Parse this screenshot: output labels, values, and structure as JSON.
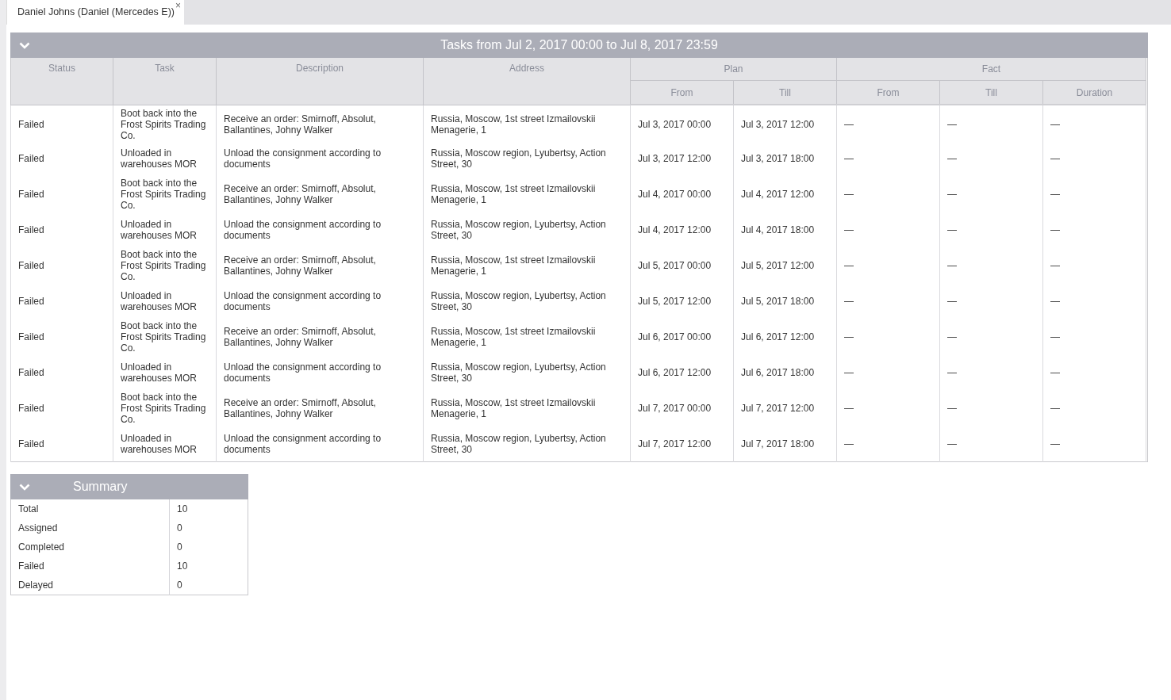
{
  "tab": {
    "label": "Daniel Johns (Daniel (Mercedes E))",
    "close": "×"
  },
  "tasks": {
    "title": "Tasks from Jul 2, 2017 00:00 to Jul 8, 2017 23:59",
    "columns": [
      "Status",
      "Task",
      "Description",
      "Address"
    ],
    "groups": [
      {
        "label": "Plan",
        "columns": [
          "From",
          "Till"
        ]
      },
      {
        "label": "Fact",
        "columns": [
          "From",
          "Till",
          "Duration"
        ]
      }
    ],
    "rows": [
      {
        "status": "Failed",
        "task": "Boot back into the Frost Spirits Trading Co.",
        "description": "Receive an order: Smirnoff, Absolut, Ballantines, Johny Walker",
        "address": "Russia, Moscow, 1st street Izmailovskii Menagerie, 1",
        "plan_from": "Jul 3, 2017 00:00",
        "plan_till": "Jul 3, 2017 12:00",
        "fact_from": "—",
        "fact_till": "—",
        "duration": "—"
      },
      {
        "status": "Failed",
        "task": "Unloaded in warehouses MOR",
        "description": "Unload the consignment according to documents",
        "address": "Russia, Moscow region, Lyubertsy, Action Street, 30",
        "plan_from": "Jul 3, 2017 12:00",
        "plan_till": "Jul 3, 2017 18:00",
        "fact_from": "—",
        "fact_till": "—",
        "duration": "—"
      },
      {
        "status": "Failed",
        "task": "Boot back into the Frost Spirits Trading Co.",
        "description": "Receive an order: Smirnoff, Absolut, Ballantines, Johny Walker",
        "address": "Russia, Moscow, 1st street Izmailovskii Menagerie, 1",
        "plan_from": "Jul 4, 2017 00:00",
        "plan_till": "Jul 4, 2017 12:00",
        "fact_from": "—",
        "fact_till": "—",
        "duration": "—"
      },
      {
        "status": "Failed",
        "task": "Unloaded in warehouses MOR",
        "description": "Unload the consignment according to documents",
        "address": "Russia, Moscow region, Lyubertsy, Action Street, 30",
        "plan_from": "Jul 4, 2017 12:00",
        "plan_till": "Jul 4, 2017 18:00",
        "fact_from": "—",
        "fact_till": "—",
        "duration": "—"
      },
      {
        "status": "Failed",
        "task": "Boot back into the Frost Spirits Trading Co.",
        "description": "Receive an order: Smirnoff, Absolut, Ballantines, Johny Walker",
        "address": "Russia, Moscow, 1st street Izmailovskii Menagerie, 1",
        "plan_from": "Jul 5, 2017 00:00",
        "plan_till": "Jul 5, 2017 12:00",
        "fact_from": "—",
        "fact_till": "—",
        "duration": "—"
      },
      {
        "status": "Failed",
        "task": "Unloaded in warehouses MOR",
        "description": "Unload the consignment according to documents",
        "address": "Russia, Moscow region, Lyubertsy, Action Street, 30",
        "plan_from": "Jul 5, 2017 12:00",
        "plan_till": "Jul 5, 2017 18:00",
        "fact_from": "—",
        "fact_till": "—",
        "duration": "—"
      },
      {
        "status": "Failed",
        "task": "Boot back into the Frost Spirits Trading Co.",
        "description": "Receive an order: Smirnoff, Absolut, Ballantines, Johny Walker",
        "address": "Russia, Moscow, 1st street Izmailovskii Menagerie, 1",
        "plan_from": "Jul 6, 2017 00:00",
        "plan_till": "Jul 6, 2017 12:00",
        "fact_from": "—",
        "fact_till": "—",
        "duration": "—"
      },
      {
        "status": "Failed",
        "task": "Unloaded in warehouses MOR",
        "description": "Unload the consignment according to documents",
        "address": "Russia, Moscow region, Lyubertsy, Action Street, 30",
        "plan_from": "Jul 6, 2017 12:00",
        "plan_till": "Jul 6, 2017 18:00",
        "fact_from": "—",
        "fact_till": "—",
        "duration": "—"
      },
      {
        "status": "Failed",
        "task": "Boot back into the Frost Spirits Trading Co.",
        "description": "Receive an order: Smirnoff, Absolut, Ballantines, Johny Walker",
        "address": "Russia, Moscow, 1st street Izmailovskii Menagerie, 1",
        "plan_from": "Jul 7, 2017 00:00",
        "plan_till": "Jul 7, 2017 12:00",
        "fact_from": "—",
        "fact_till": "—",
        "duration": "—"
      },
      {
        "status": "Failed",
        "task": "Unloaded in warehouses MOR",
        "description": "Unload the consignment according to documents",
        "address": "Russia, Moscow region, Lyubertsy, Action Street, 30",
        "plan_from": "Jul 7, 2017 12:00",
        "plan_till": "Jul 7, 2017 18:00",
        "fact_from": "—",
        "fact_till": "—",
        "duration": "—"
      }
    ]
  },
  "summary": {
    "title": "Summary",
    "rows": [
      {
        "label": "Total",
        "value": "10"
      },
      {
        "label": "Assigned",
        "value": "0"
      },
      {
        "label": "Completed",
        "value": "0"
      },
      {
        "label": "Failed",
        "value": "10"
      },
      {
        "label": "Delayed",
        "value": "0"
      }
    ]
  }
}
